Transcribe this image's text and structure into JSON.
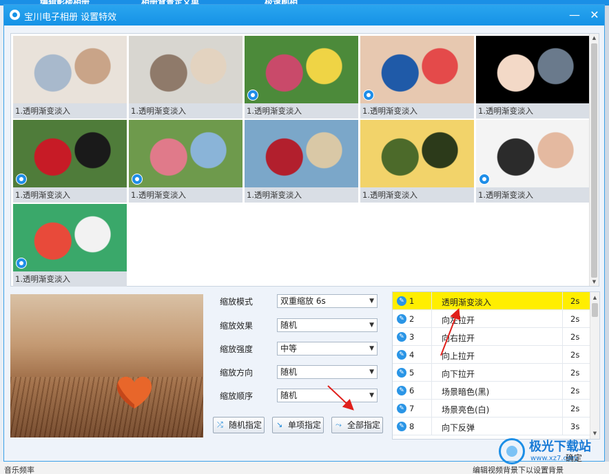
{
  "background": {
    "top_tabs": [
      "编辑影楼相册",
      "相册背景定义单",
      "极速刷相"
    ],
    "bottom_texts": [
      "音乐频率",
      "编辑视频背景下以设置背景"
    ]
  },
  "window": {
    "title": "宝川电子相册  设置特效",
    "minimize_label": "—",
    "close_label": "✕"
  },
  "gallery": {
    "thumbnails": [
      {
        "caption": "1.透明渐变淡入",
        "colors": [
          "#e9e2da",
          "#a8b9cc",
          "#c9a488"
        ],
        "has_eye": false
      },
      {
        "caption": "1.透明渐变淡入",
        "colors": [
          "#d8d6d0",
          "#8f7a6a",
          "#e3d3c0"
        ],
        "has_eye": false
      },
      {
        "caption": "1.透明渐变淡入",
        "colors": [
          "#4c8a3a",
          "#c94a6a",
          "#efd445"
        ],
        "has_eye": true
      },
      {
        "caption": "1.透明渐变淡入",
        "colors": [
          "#e7c8b0",
          "#1f5aa8",
          "#e44a4a"
        ],
        "has_eye": true
      },
      {
        "caption": "1.透明渐变淡入",
        "colors": [
          "#000000",
          "#f3d9c7",
          "#6a7a8c"
        ],
        "has_eye": false
      },
      {
        "caption": "1.透明渐变淡入",
        "colors": [
          "#4f7c3a",
          "#c71b26",
          "#1a1a1a"
        ],
        "has_eye": true
      },
      {
        "caption": "1.透明渐变淡入",
        "colors": [
          "#6e9a4c",
          "#e07a8a",
          "#8ab4d8"
        ],
        "has_eye": true
      },
      {
        "caption": "1.透明渐变淡入",
        "colors": [
          "#7ba7c9",
          "#b21f2d",
          "#d9c8a6"
        ],
        "has_eye": false
      },
      {
        "caption": "1.透明渐变淡入",
        "colors": [
          "#f2d36a",
          "#4c6a2a",
          "#2c3a1a"
        ],
        "has_eye": false
      },
      {
        "caption": "1.透明渐变淡入",
        "colors": [
          "#f4f4f4",
          "#2b2b2b",
          "#e4b9a0"
        ],
        "has_eye": true
      },
      {
        "caption": "1.透明渐变淡入",
        "colors": [
          "#3aa86a",
          "#e84a3a",
          "#f2f2f2"
        ],
        "has_eye": true
      }
    ]
  },
  "settings": {
    "rows": [
      {
        "label": "缩放模式",
        "value": "双重缩放  6s"
      },
      {
        "label": "缩放效果",
        "value": "随机"
      },
      {
        "label": "缩放强度",
        "value": "中等"
      },
      {
        "label": "缩放方向",
        "value": "随机"
      },
      {
        "label": "缩放顺序",
        "value": "随机"
      }
    ],
    "buttons": {
      "random": "随机指定",
      "single": "单项指定",
      "all": "全部指定"
    }
  },
  "effects": {
    "selected_index": 0,
    "selected_color": "#ffee00",
    "rows": [
      {
        "num": "1",
        "name": "透明渐变淡入",
        "duration": "2s"
      },
      {
        "num": "2",
        "name": "向左拉开",
        "duration": "2s"
      },
      {
        "num": "3",
        "name": "向右拉开",
        "duration": "2s"
      },
      {
        "num": "4",
        "name": "向上拉开",
        "duration": "2s"
      },
      {
        "num": "5",
        "name": "向下拉开",
        "duration": "2s"
      },
      {
        "num": "6",
        "name": "场景暗色(黑)",
        "duration": "2s"
      },
      {
        "num": "7",
        "name": "场景亮色(白)",
        "duration": "2s"
      },
      {
        "num": "8",
        "name": "向下反弹",
        "duration": "3s"
      }
    ]
  },
  "footer": {
    "ok_label": "确定"
  },
  "watermark": {
    "title": "极光下载站",
    "url": "www.xz7.com"
  },
  "accent": "#1592e6",
  "annotation_color": "#e0201c"
}
